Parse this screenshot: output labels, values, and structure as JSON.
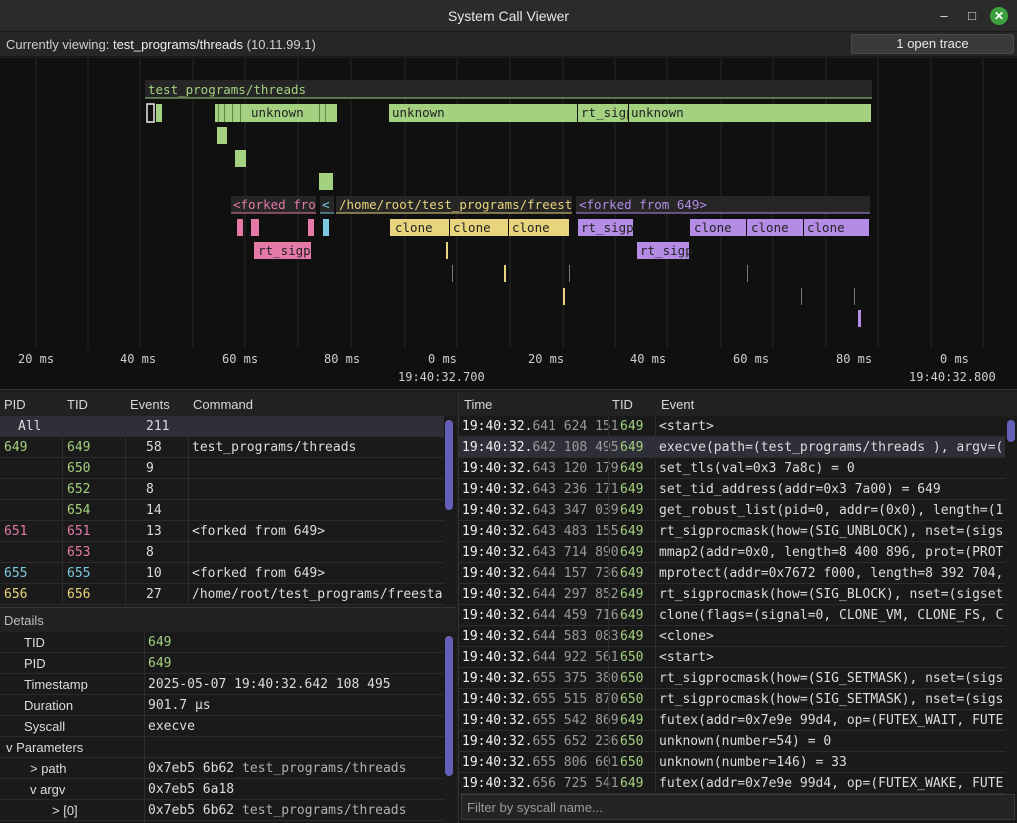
{
  "window": {
    "title": "System Call Viewer"
  },
  "viewbar": {
    "prefix": "Currently viewing:",
    "trace_name": "test_programs/threads",
    "address": "(10.11.99.1)",
    "open_trace_label": "1 open trace"
  },
  "timeline": {
    "tick_labels": [
      "20 ms",
      "40 ms",
      "60 ms",
      "80 ms",
      "0 ms",
      "20 ms",
      "40 ms",
      "60 ms",
      "80 ms",
      "0 ms"
    ],
    "timestamps": [
      "19:40:32.700",
      "19:40:32.800"
    ],
    "groups": [
      {
        "label": "test_programs/threads",
        "color": "#a3d17f"
      },
      {
        "label": "<forked fro",
        "color": "#e57aa8"
      },
      {
        "label": "<",
        "color": "#7cc8e0"
      },
      {
        "label": "/home/root/test_programs/freest",
        "color": "#e8d47c"
      },
      {
        "label": "<forked from 649>",
        "color": "#b48ce6"
      }
    ],
    "bar_labels": {
      "g1": [
        "unknown",
        "unknown",
        "rt_sigp",
        "unknown"
      ],
      "pink": [
        "rt_sigp"
      ],
      "yellow": [
        "clone",
        "clone",
        "clone"
      ],
      "purple": [
        "rt_sigp",
        "clone",
        "clone",
        "clone",
        "rt_sigp"
      ]
    }
  },
  "pid_table": {
    "headers": {
      "pid": "PID",
      "tid": "TID",
      "events": "Events",
      "command": "Command"
    },
    "rows": [
      {
        "pid": "All",
        "tid": "",
        "events": "211",
        "command": ""
      },
      {
        "pid": "649",
        "tid": "649",
        "events": "58",
        "command": "test_programs/threads"
      },
      {
        "pid": "",
        "tid": "650",
        "events": "9",
        "command": ""
      },
      {
        "pid": "",
        "tid": "652",
        "events": "8",
        "command": ""
      },
      {
        "pid": "",
        "tid": "654",
        "events": "14",
        "command": ""
      },
      {
        "pid": "651",
        "tid": "651",
        "events": "13",
        "command": "<forked from 649>"
      },
      {
        "pid": "",
        "tid": "653",
        "events": "8",
        "command": ""
      },
      {
        "pid": "655",
        "tid": "655",
        "events": "10",
        "command": "<forked from 649>"
      },
      {
        "pid": "656",
        "tid": "656",
        "events": "27",
        "command": "/home/root/test_programs/freestan"
      }
    ]
  },
  "details": {
    "header": "Details",
    "rows": [
      {
        "key": "TID",
        "value": "649"
      },
      {
        "key": "PID",
        "value": "649"
      },
      {
        "key": "Timestamp",
        "value": "2025-05-07 19:40:32.642 108 495"
      },
      {
        "key": "Duration",
        "value": "901.7 µs"
      },
      {
        "key": "Syscall",
        "value": "execve"
      },
      {
        "key": "v Parameters",
        "value": ""
      },
      {
        "key": "> path",
        "value_addr": "0x7eb5 6b62",
        "value": "test_programs/threads"
      },
      {
        "key": "v argv",
        "value_addr": "0x7eb5 6a18",
        "value": ""
      },
      {
        "key": "> [0]",
        "value_addr": "0x7eb5 6b62",
        "value": "test_programs/threads"
      }
    ]
  },
  "events": {
    "headers": {
      "time": "Time",
      "tid": "TID",
      "event": "Event"
    },
    "rows": [
      {
        "ts_a": "19:40:32.",
        "ts_b": "641 624 151",
        "tid": "649",
        "event": "<start>"
      },
      {
        "ts_a": "19:40:32.",
        "ts_b": "642 108 495",
        "tid": "649",
        "event": "execve(path=(test_programs/threads ), argv=(("
      },
      {
        "ts_a": "19:40:32.",
        "ts_b": "643 120 179",
        "tid": "649",
        "event": "set_tls(val=0x3 7a8c) = 0"
      },
      {
        "ts_a": "19:40:32.",
        "ts_b": "643 236 171",
        "tid": "649",
        "event": "set_tid_address(addr=0x3 7a00) = 649"
      },
      {
        "ts_a": "19:40:32.",
        "ts_b": "643 347 039",
        "tid": "649",
        "event": "get_robust_list(pid=0, addr=(0x0), length=(12"
      },
      {
        "ts_a": "19:40:32.",
        "ts_b": "643 483 155",
        "tid": "649",
        "event": "rt_sigprocmask(how=(SIG_UNBLOCK), nset=(sigse"
      },
      {
        "ts_a": "19:40:32.",
        "ts_b": "643 714 890",
        "tid": "649",
        "event": "mmap2(addr=0x0, length=8 400 896, prot=(PROT_N"
      },
      {
        "ts_a": "19:40:32.",
        "ts_b": "644 157 736",
        "tid": "649",
        "event": "mprotect(addr=0x7672 f000, length=8 392 704, pr"
      },
      {
        "ts_a": "19:40:32.",
        "ts_b": "644 297 852",
        "tid": "649",
        "event": "rt_sigprocmask(how=(SIG_BLOCK), nset=(sigset="
      },
      {
        "ts_a": "19:40:32.",
        "ts_b": "644 459 716",
        "tid": "649",
        "event": "clone(flags=(signal=0, CLONE_VM, CLONE_FS, CLO"
      },
      {
        "ts_a": "19:40:32.",
        "ts_b": "644 583 083",
        "tid": "649",
        "event": "<clone>"
      },
      {
        "ts_a": "19:40:32.",
        "ts_b": "644 922 561",
        "tid": "650",
        "event": "<start>"
      },
      {
        "ts_a": "19:40:32.",
        "ts_b": "655 375 380",
        "tid": "650",
        "event": "rt_sigprocmask(how=(SIG_SETMASK), nset=(sigse"
      },
      {
        "ts_a": "19:40:32.",
        "ts_b": "655 515 870",
        "tid": "650",
        "event": "rt_sigprocmask(how=(SIG_SETMASK), nset=(sigse"
      },
      {
        "ts_a": "19:40:32.",
        "ts_b": "655 542 869",
        "tid": "649",
        "event": "futex(addr=0x7e9e 99d4, op=(FUTEX_WAIT, FUTEX_"
      },
      {
        "ts_a": "19:40:32.",
        "ts_b": "655 652 236",
        "tid": "650",
        "event": "unknown(number=54) = 0"
      },
      {
        "ts_a": "19:40:32.",
        "ts_b": "655 806 601",
        "tid": "650",
        "event": "unknown(number=146) = 33"
      },
      {
        "ts_a": "19:40:32.",
        "ts_b": "656 725 541",
        "tid": "649",
        "event": "futex(addr=0x7e9e 99d4, op=(FUTEX_WAKE, FUTEX_"
      }
    ],
    "filter_placeholder": "Filter by syscall name..."
  },
  "colors": {
    "green": "#a3d17f",
    "pink": "#e57aa8",
    "cyan": "#7cc8e0",
    "yellow": "#e8d47c",
    "purple": "#b48ce6",
    "accent": "#6460b8"
  }
}
